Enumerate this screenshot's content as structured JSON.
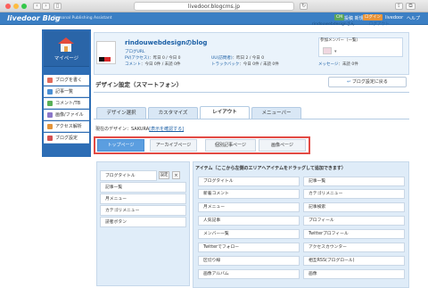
{
  "browser": {
    "url": "livedoor.blogcms.jp"
  },
  "topbar": {
    "logo": "livedoor Blog",
    "tagline": "Personal Publishing Assistant",
    "badge1": "CM",
    "badge1_text": "投稿 新規",
    "badge2": "ログイン",
    "link_livedoor": "livedoor",
    "link_help": "ヘルプ",
    "welcome": "rindouwebdesignさん",
    "logout": "ログアウト"
  },
  "sidebar": {
    "mypage": "マイページ",
    "items": [
      {
        "label": "ブログを書く",
        "color": "#e26a5a"
      },
      {
        "label": "記事一覧",
        "color": "#4a8fd4"
      },
      {
        "label": "コメント/TB",
        "color": "#59b058"
      },
      {
        "label": "画像/ファイル",
        "color": "#8a77c8"
      },
      {
        "label": "アクセス解析",
        "color": "#e3943a"
      },
      {
        "label": "ブログ設定",
        "color": "#d45050"
      }
    ]
  },
  "header": {
    "blog_title": "rindouwebdesignのblog",
    "url_label": "ブログURL",
    "pv_label": "PV(アクセス)",
    "pv_value": "：昨日 0 / 今日 0",
    "uu_label": "UU(訪問者)",
    "uu_value": "：昨日 2 / 今日 0",
    "comment_label": "コメント",
    "comment_value": "：今日 0件 / 未読 0件",
    "tb_label": "トラックバック",
    "tb_value": "：今日 0件 / 未読 0件",
    "msg_label": "メッセージ",
    "msg_value": "：未読 0件",
    "member_label": "参加メンバー（一覧）"
  },
  "section": {
    "title": "デザイン設定（スマートフォン）",
    "back_button": "ブログ設定に戻る"
  },
  "tabs": [
    "デザイン選択",
    "カスタマイズ",
    "レイアウト",
    "メニューバー"
  ],
  "active_tab": "レイアウト",
  "current_design": {
    "prefix": "現在のデザイン：SAKURA",
    "link": "[表示を確認する]"
  },
  "subtabs": [
    "トップページ",
    "アーカイブページ",
    "個別記事ページ",
    "画像ページ"
  ],
  "left_panel": {
    "config_button": "設定",
    "close_button": "×",
    "rows": [
      "ブログタイトル",
      "記事一覧",
      "月メニュー",
      "カテゴリメニュー",
      "読者ボタン"
    ]
  },
  "right_panel": {
    "heading": "アイテム（ここから左側のエリアへアイテムをドラッグして追加できます）",
    "items": [
      "ブログタイトル",
      "記事一覧",
      "新着コメント",
      "カテゴリメニュー",
      "月メニュー",
      "記事検索",
      "人気記事",
      "プロフィール",
      "メンバー一覧",
      "Twitterプロフィール",
      "Twitterでフォロー",
      "アクセスカウンター",
      "区切り線",
      "相互RSS(ブログロール)",
      "画像アルバム",
      "画像"
    ]
  }
}
